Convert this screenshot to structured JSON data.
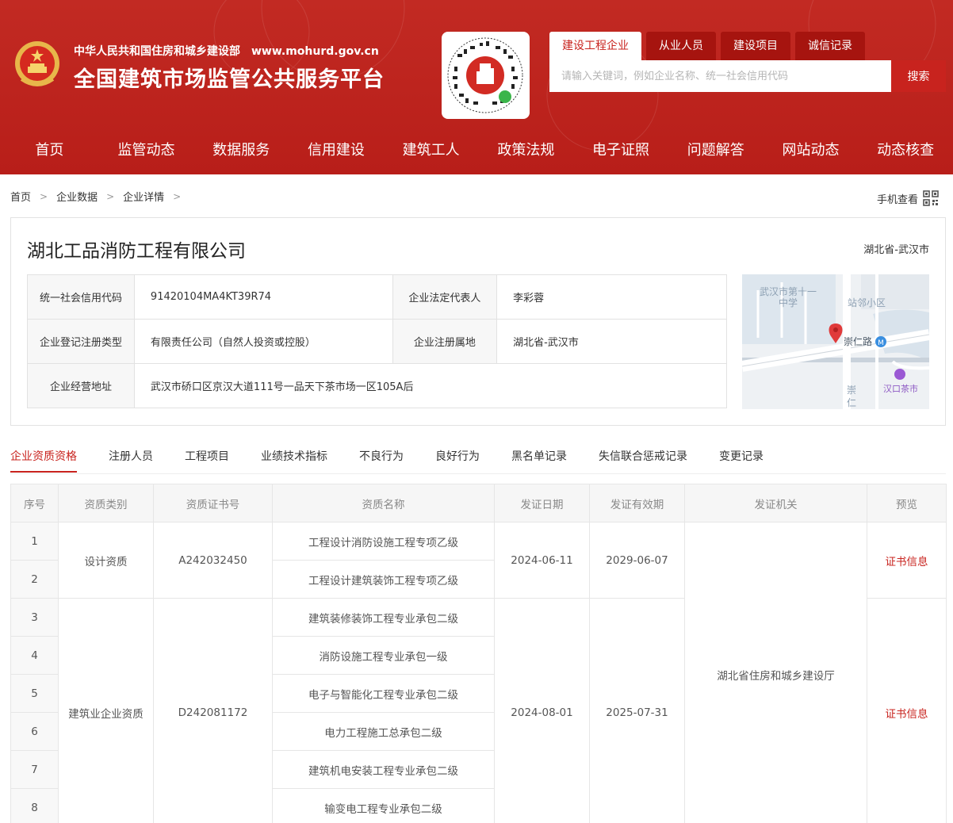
{
  "header": {
    "ministry": "中华人民共和国住房和城乡建设部",
    "url": "www.mohurd.gov.cn",
    "title": "全国建筑市场监管公共服务平台"
  },
  "search": {
    "tabs": [
      "建设工程企业",
      "从业人员",
      "建设项目",
      "诚信记录"
    ],
    "placeholder": "请输入关键词，例如企业名称、统一社会信用代码",
    "button": "搜索"
  },
  "nav": [
    "首页",
    "监管动态",
    "数据服务",
    "信用建设",
    "建筑工人",
    "政策法规",
    "电子证照",
    "问题解答",
    "网站动态",
    "动态核查"
  ],
  "breadcrumb": [
    "首页",
    "企业数据",
    "企业详情"
  ],
  "mobile_view": "手机查看",
  "company": {
    "name": "湖北工品消防工程有限公司",
    "region": "湖北省-武汉市",
    "credit_code_label": "统一社会信用代码",
    "credit_code": "91420104MA4KT39R74",
    "legal_rep_label": "企业法定代表人",
    "legal_rep": "李彩蓉",
    "reg_type_label": "企业登记注册类型",
    "reg_type": "有限责任公司（自然人投资或控股）",
    "reg_place_label": "企业注册属地",
    "reg_place": "湖北省-武汉市",
    "address_label": "企业经营地址",
    "address": "武汉市硚口区京汉大道111号一品天下茶市场一区105A后"
  },
  "map": {
    "labels": [
      "武汉市第十一",
      "中学",
      "站邻小区",
      "崇仁路",
      "汉口茶市",
      "崇",
      "仁"
    ]
  },
  "tabs": [
    "企业资质资格",
    "注册人员",
    "工程项目",
    "业绩技术指标",
    "不良行为",
    "良好行为",
    "黑名单记录",
    "失信联合惩戒记录",
    "变更记录"
  ],
  "qual_table": {
    "headers": [
      "序号",
      "资质类别",
      "资质证书号",
      "资质名称",
      "发证日期",
      "发证有效期",
      "发证机关",
      "预览"
    ],
    "groups": [
      {
        "category": "设计资质",
        "cert_no": "A242032450",
        "issue_date": "2024-06-11",
        "valid_until": "2029-06-07",
        "preview": "证书信息",
        "rows": [
          {
            "no": "1",
            "name": "工程设计消防设施工程专项乙级"
          },
          {
            "no": "2",
            "name": "工程设计建筑装饰工程专项乙级"
          }
        ]
      },
      {
        "category": "建筑业企业资质",
        "cert_no": "D242081172",
        "issue_date": "2024-08-01",
        "valid_until": "2025-07-31",
        "preview": "证书信息",
        "rows": [
          {
            "no": "3",
            "name": "建筑装修装饰工程专业承包二级"
          },
          {
            "no": "4",
            "name": "消防设施工程专业承包一级"
          },
          {
            "no": "5",
            "name": "电子与智能化工程专业承包二级"
          },
          {
            "no": "6",
            "name": "电力工程施工总承包二级"
          },
          {
            "no": "7",
            "name": "建筑机电安装工程专业承包二级"
          },
          {
            "no": "8",
            "name": "输变电工程专业承包二级"
          }
        ]
      }
    ],
    "authority": "湖北省住房和城乡建设厅"
  }
}
